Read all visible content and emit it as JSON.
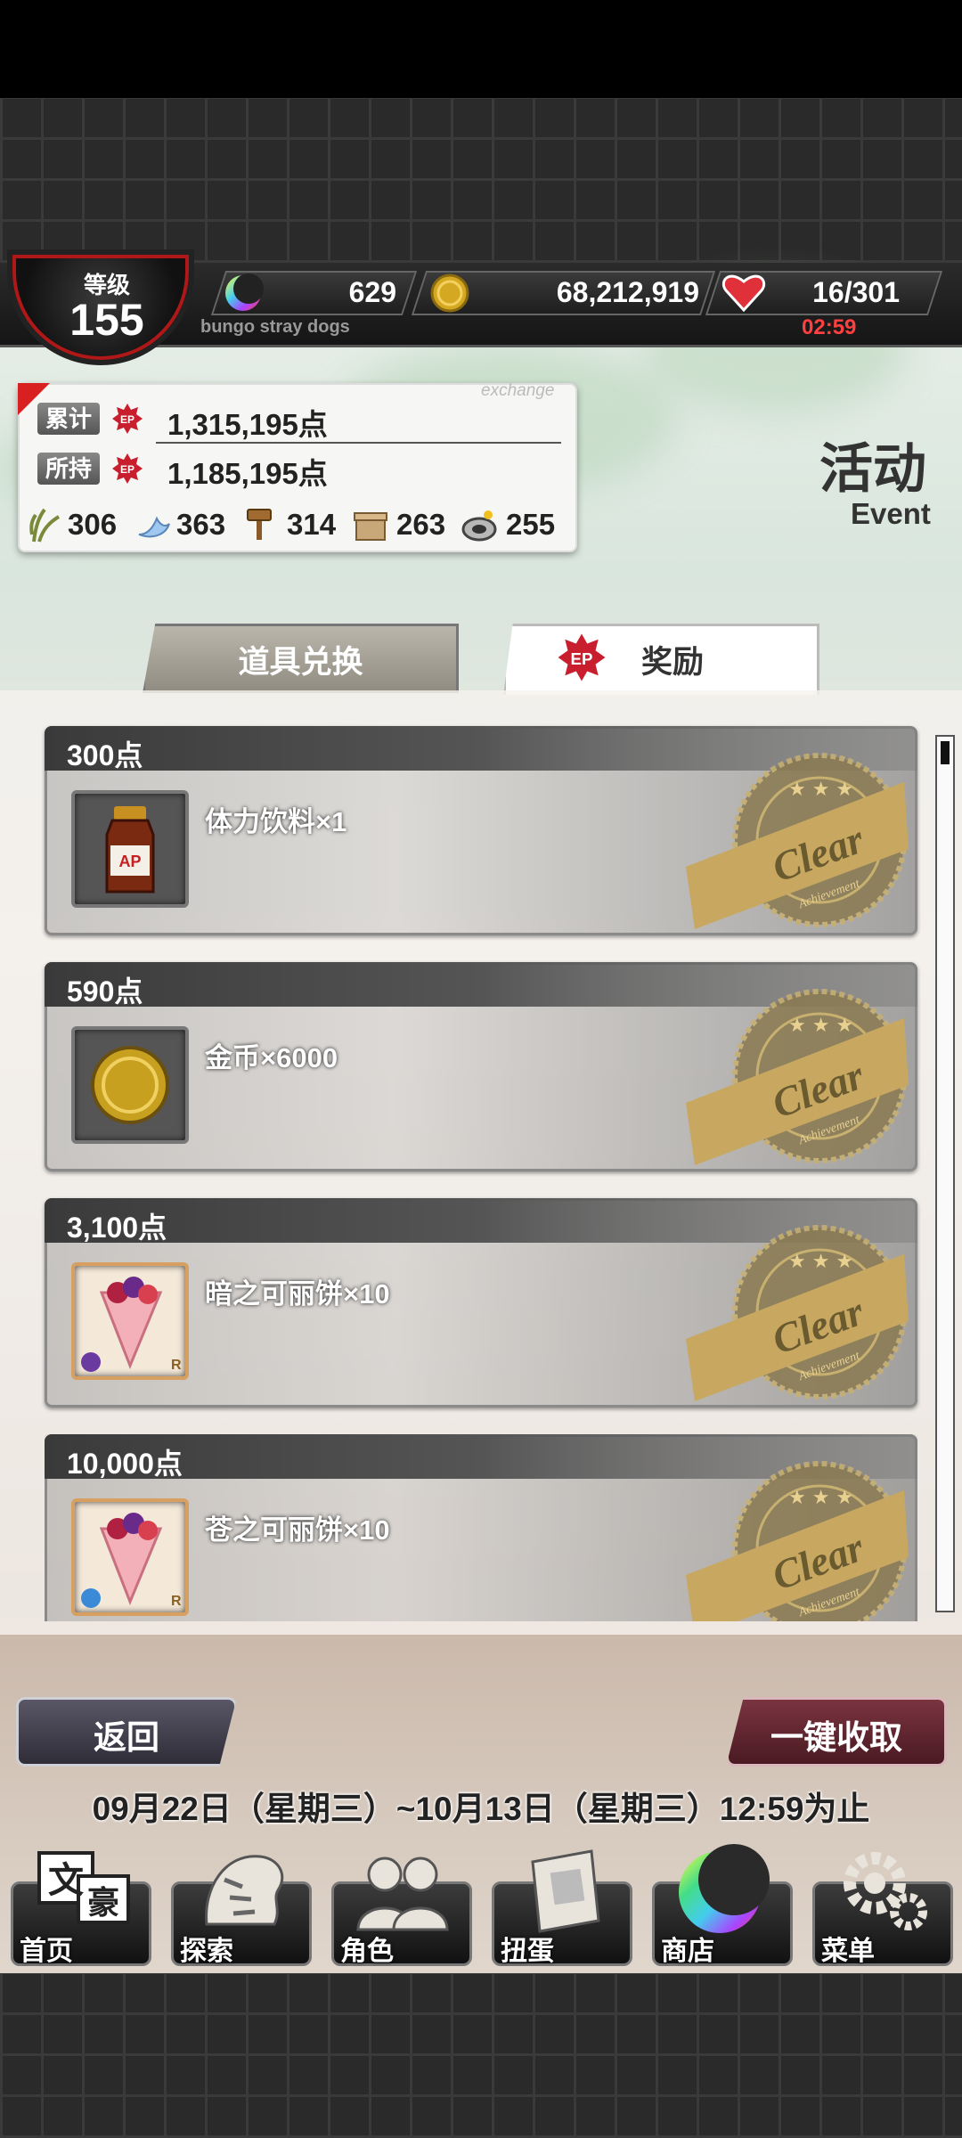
{
  "status": {
    "level_label": "等级",
    "level_value": "155",
    "crescent_value": "629",
    "coin_value": "68,212,919",
    "stamina_value": "16/301",
    "timer": "02:59",
    "game_subtitle": "bungo stray dogs"
  },
  "points_panel": {
    "exchange_word": "exchange",
    "cumulative_label": "累计",
    "cumulative_value": "1,315,195点",
    "held_label": "所持",
    "held_value": "1,185,195点",
    "ep_badge_text": "EP",
    "materials": [
      {
        "icon": "grass-icon",
        "value": "306"
      },
      {
        "icon": "wing-icon",
        "value": "363"
      },
      {
        "icon": "hammer-icon",
        "value": "314"
      },
      {
        "icon": "box-icon",
        "value": "263"
      },
      {
        "icon": "ring-icon",
        "value": "255"
      }
    ]
  },
  "event": {
    "title_cn": "活动",
    "title_en": "Event"
  },
  "tabs": {
    "items": "道具兑换",
    "rewards": "奖励"
  },
  "rewards": [
    {
      "points": "300点",
      "label": "体力饮料×1",
      "icon": "energy-drink-icon",
      "stamp": "Clear"
    },
    {
      "points": "590点",
      "label": "金币×6000",
      "icon": "gold-coin-icon",
      "stamp": "Clear"
    },
    {
      "points": "3,100点",
      "label": "暗之可丽饼×10",
      "icon": "crepe-icon",
      "stamp": "Clear"
    },
    {
      "points": "10,000点",
      "label": "苍之可丽饼×10",
      "icon": "crepe-icon",
      "stamp": "Clear"
    }
  ],
  "stamp_sub": "Achievement",
  "crepe_rank": "R",
  "actions": {
    "back": "返回",
    "collect_all": "一键收取",
    "period": "09月22日（星期三）~10月13日（星期三）12:59为止"
  },
  "nav": [
    {
      "label": "首页",
      "icon": "home-icon"
    },
    {
      "label": "探索",
      "icon": "tiger-icon"
    },
    {
      "label": "角色",
      "icon": "people-icon"
    },
    {
      "label": "扭蛋",
      "icon": "book-icon"
    },
    {
      "label": "商店",
      "icon": "crescent-shop-icon"
    },
    {
      "label": "菜单",
      "icon": "gear-icon"
    }
  ],
  "colors": {
    "accent_red": "#d92020",
    "timer_red": "#ff4040",
    "stamp_gold": "#b8a060"
  }
}
